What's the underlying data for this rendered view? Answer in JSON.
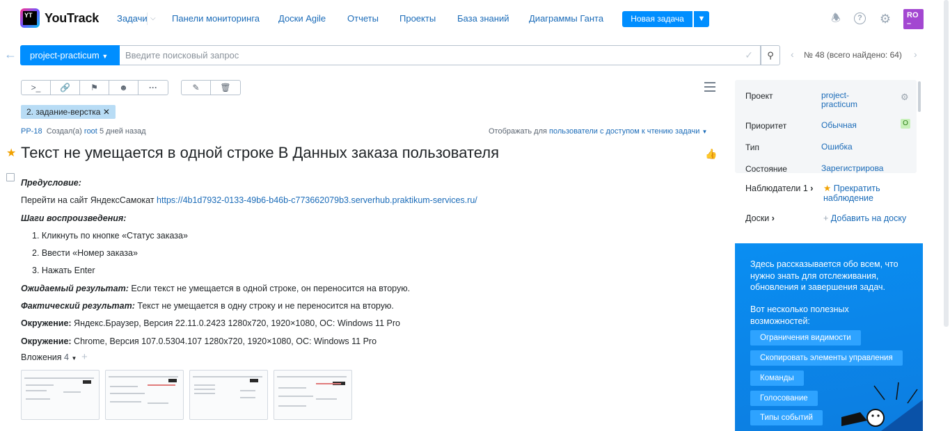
{
  "app": {
    "logo_mark": "YT",
    "logo_text": "YouTrack"
  },
  "nav": {
    "items": [
      {
        "label": "Задачи"
      },
      {
        "label": "Панели мониторинга"
      },
      {
        "label": "Доски Agile"
      },
      {
        "label": "Отчеты"
      },
      {
        "label": "Проекты"
      },
      {
        "label": "База знаний"
      },
      {
        "label": "Диаграммы Ганта"
      }
    ],
    "new_issue_label": "Новая задача",
    "avatar_initials": "RO"
  },
  "search": {
    "project": "project-practicum",
    "placeholder": "Введите поисковый запрос",
    "result_counter": "№ 48 (всего найдено: 64)"
  },
  "issue": {
    "tag": "2. задание-верстка",
    "id": "PP-18",
    "created_prefix": "Создал(а)",
    "author": "root",
    "created_when": "5 дней назад",
    "visibility_prefix": "Отображать для",
    "visibility_value": "пользователи с доступом к чтению задачи",
    "title": "Текст не умещается в одной строке В Данных заказа пользователя",
    "precondition_label": "Предусловие:",
    "precondition_text": "Перейти на сайт ЯндексСамокат",
    "precondition_link": "https://4b1d7932-0133-49b6-b46b-c773662079b3.serverhub.praktikum-services.ru/",
    "steps_label": "Шаги воспроизведения:",
    "steps": [
      "1. Кликнуть по кнопке «Статус заказа»",
      "2. Ввести «Номер заказа»",
      "3. Нажать Enter"
    ],
    "expected_label": "Ожидаемый результат:",
    "expected_text": "Если текст не умещается в одной строке, он переносится на вторую.",
    "actual_label": "Фактический результат:",
    "actual_text": "Текст не умещается в одну строку и не переносится на вторую.",
    "env_label": "Окружение:",
    "env1_text": "Яндекс.Браузер, Версия 22.11.0.2423 1280x720, 1920×1080, ОС: Windows 11 Pro",
    "env2_text": "Chrome, Версия 107.0.5304.107 1280x720, 1920×1080, ОС: Windows 11 Pro",
    "attachments_label": "Вложения",
    "attachments_count": "4"
  },
  "fields": {
    "project_label": "Проект",
    "project_value": "project-practicum",
    "priority_label": "Приоритет",
    "priority_value": "Обычная",
    "priority_badge": "О",
    "type_label": "Тип",
    "type_value": "Ошибка",
    "state_label": "Состояние",
    "state_value": "Зарегистрирова"
  },
  "side": {
    "watchers_label": "Наблюдатели 1",
    "stop_watching": "Прекратить наблюдение",
    "boards_label": "Доски",
    "add_to_board": "Добавить на доску"
  },
  "promo": {
    "intro": "Здесь рассказывается обо всем, что нужно знать для отслеживания, обновления и завершения задач.",
    "features_title": "Вот несколько полезных возможностей:",
    "chips": [
      "Ограничения видимости",
      "Скопировать элементы управления",
      "Команды",
      "Голосование",
      "Типы событий"
    ]
  },
  "colors": {
    "accent": "#008eff",
    "link": "#1a6bb8",
    "tag_bg": "#b8dcf5",
    "promo_bg": "#0a8ef2",
    "star": "#f1a100"
  }
}
